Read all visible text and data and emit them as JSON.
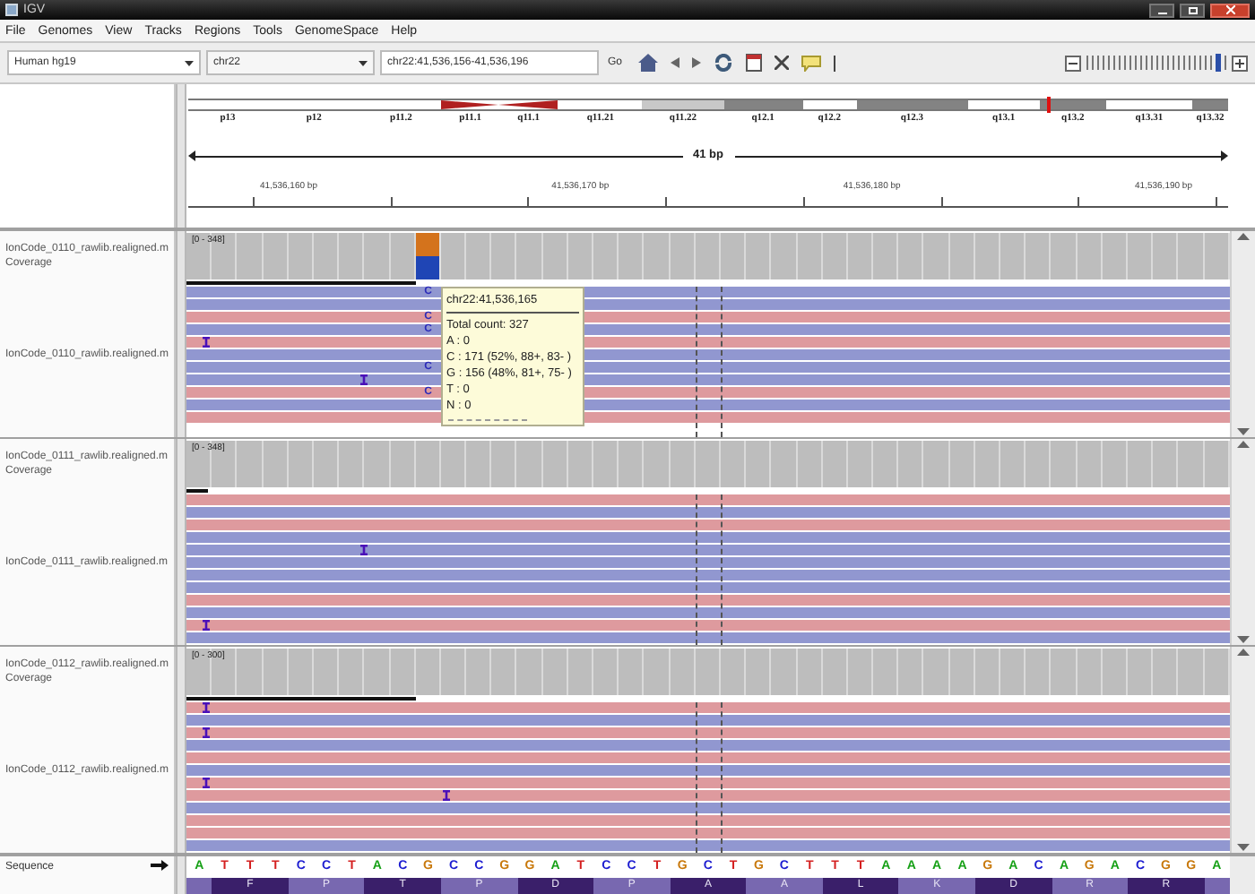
{
  "window": {
    "title": "IGV"
  },
  "menu": [
    "File",
    "Genomes",
    "View",
    "Tracks",
    "Regions",
    "Tools",
    "GenomeSpace",
    "Help"
  ],
  "toolbar": {
    "genome": "Human hg19",
    "chromosome": "chr22",
    "locus": "chr22:41,536,156-41,536,196",
    "go": "Go",
    "zoom": {
      "level": 0.96
    }
  },
  "ideogram": {
    "bands": [
      {
        "label": "p13",
        "kind": "white",
        "current": false
      },
      {
        "label": "p12",
        "kind": "white",
        "current": false
      },
      {
        "label": "p11.2",
        "kind": "white",
        "current": false
      },
      {
        "label": "p11.1",
        "kind": "pwedge",
        "current": false
      },
      {
        "label": "q11.1",
        "kind": "qwedge",
        "current": false
      },
      {
        "label": "q11.21",
        "kind": "white",
        "current": false
      },
      {
        "label": "q11.22",
        "kind": "light",
        "current": false
      },
      {
        "label": "q12.1",
        "kind": "dark",
        "current": false
      },
      {
        "label": "q12.2",
        "kind": "white",
        "current": false
      },
      {
        "label": "q12.3",
        "kind": "dark",
        "current": false
      },
      {
        "label": "q13.1",
        "kind": "white",
        "current": false
      },
      {
        "label": "q13.2",
        "kind": "dark",
        "current": true
      },
      {
        "label": "q13.31",
        "kind": "white",
        "current": false
      },
      {
        "label": "q13.32",
        "kind": "dark",
        "current": false
      }
    ]
  },
  "ruler": {
    "span": "41 bp",
    "ticks": [
      "41,536,160 bp",
      "41,536,170 bp",
      "41,536,180 bp",
      "41,536,190 bp"
    ]
  },
  "tracks": [
    {
      "coverage_label": "IonCode_0110_rawlib.realigned.m Coverage",
      "range": "[0 - 348]",
      "variant_shown": true,
      "alignment_label": "IonCode_0110_rawlib.realigned.m",
      "reads": [
        {
          "kind": "reverse",
          "mismatch": "C",
          "insertion": false
        },
        {
          "kind": "reverse",
          "insertion": false
        },
        {
          "kind": "forward",
          "mismatch": "C",
          "insertion": false
        },
        {
          "kind": "reverse",
          "mismatch": "C",
          "insertion": false
        },
        {
          "kind": "forward",
          "insertion": true
        },
        {
          "kind": "reverse",
          "insertion": false
        },
        {
          "kind": "reverse",
          "mismatch": "C",
          "insertion": false
        },
        {
          "kind": "reverse",
          "insertion": true
        },
        {
          "kind": "forward",
          "mismatch": "C",
          "insertion": false
        },
        {
          "kind": "reverse",
          "insertion": false
        },
        {
          "kind": "forward",
          "insertion": false
        }
      ]
    },
    {
      "coverage_label": "IonCode_0111_rawlib.realigned.m Coverage",
      "range": "[0 - 348]",
      "variant_shown": false,
      "alignment_label": "IonCode_0111_rawlib.realigned.m",
      "reads": [
        {
          "kind": "forward",
          "insertion": false
        },
        {
          "kind": "reverse",
          "insertion": false
        },
        {
          "kind": "forward",
          "insertion": false
        },
        {
          "kind": "reverse",
          "insertion": false
        },
        {
          "kind": "reverse",
          "insertion": true
        },
        {
          "kind": "reverse",
          "insertion": false
        },
        {
          "kind": "reverse",
          "insertion": false
        },
        {
          "kind": "reverse",
          "insertion": false
        },
        {
          "kind": "forward",
          "insertion": false
        },
        {
          "kind": "reverse",
          "insertion": false
        },
        {
          "kind": "forward",
          "insertion": true
        },
        {
          "kind": "reverse",
          "insertion": false
        }
      ]
    },
    {
      "coverage_label": "IonCode_0112_rawlib.realigned.m Coverage",
      "range": "[0 - 300]",
      "variant_shown": false,
      "alignment_label": "IonCode_0112_rawlib.realigned.m",
      "reads": [
        {
          "kind": "forward",
          "insertion": true
        },
        {
          "kind": "reverse",
          "insertion": false
        },
        {
          "kind": "forward",
          "insertion": true
        },
        {
          "kind": "reverse",
          "insertion": false
        },
        {
          "kind": "forward",
          "insertion": false
        },
        {
          "kind": "reverse",
          "insertion": false
        },
        {
          "kind": "forward",
          "insertion": true
        },
        {
          "kind": "forward",
          "insertion": true
        },
        {
          "kind": "reverse",
          "insertion": false
        },
        {
          "kind": "forward",
          "insertion": false
        },
        {
          "kind": "forward",
          "insertion": false
        },
        {
          "kind": "reverse",
          "insertion": false
        }
      ]
    }
  ],
  "tooltip": {
    "position": "chr22:41,536,165",
    "lines": [
      "Total count: 327",
      "A : 0",
      "C : 171 (52%, 88+, 83- )",
      "G : 156 (48%, 81+, 75- )",
      "T : 0",
      "N : 0"
    ]
  },
  "sequence": {
    "label": "Sequence",
    "bases": [
      {
        "base": "A",
        "variant": false
      },
      {
        "base": "T",
        "variant": false
      },
      {
        "base": "T",
        "variant": false
      },
      {
        "base": "T",
        "variant": false
      },
      {
        "base": "C",
        "variant": false
      },
      {
        "base": "C",
        "variant": false
      },
      {
        "base": "T",
        "variant": false
      },
      {
        "base": "A",
        "variant": false
      },
      {
        "base": "C",
        "variant": false
      },
      {
        "base": "G",
        "variant": true
      },
      {
        "base": "C",
        "variant": false
      },
      {
        "base": "C",
        "variant": false
      },
      {
        "base": "G",
        "variant": false
      },
      {
        "base": "G",
        "variant": false
      },
      {
        "base": "A",
        "variant": false
      },
      {
        "base": "T",
        "variant": false
      },
      {
        "base": "C",
        "variant": false
      },
      {
        "base": "C",
        "variant": false
      },
      {
        "base": "T",
        "variant": false
      },
      {
        "base": "G",
        "variant": false
      },
      {
        "base": "C",
        "variant": false
      },
      {
        "base": "T",
        "variant": false
      },
      {
        "base": "G",
        "variant": false
      },
      {
        "base": "C",
        "variant": false
      },
      {
        "base": "T",
        "variant": false
      },
      {
        "base": "T",
        "variant": false
      },
      {
        "base": "T",
        "variant": false
      },
      {
        "base": "A",
        "variant": false
      },
      {
        "base": "A",
        "variant": false
      },
      {
        "base": "A",
        "variant": false
      },
      {
        "base": "A",
        "variant": false
      },
      {
        "base": "G",
        "variant": false
      },
      {
        "base": "A",
        "variant": false
      },
      {
        "base": "C",
        "variant": false
      },
      {
        "base": "A",
        "variant": false
      },
      {
        "base": "G",
        "variant": false
      },
      {
        "base": "A",
        "variant": false
      },
      {
        "base": "C",
        "variant": false
      },
      {
        "base": "G",
        "variant": false
      },
      {
        "base": "G",
        "variant": false
      },
      {
        "base": "A",
        "variant": false
      }
    ],
    "translation": [
      "F",
      "P",
      "T",
      "P",
      "D",
      "P",
      "A",
      "A",
      "L",
      "K",
      "D",
      "R",
      "R"
    ]
  }
}
